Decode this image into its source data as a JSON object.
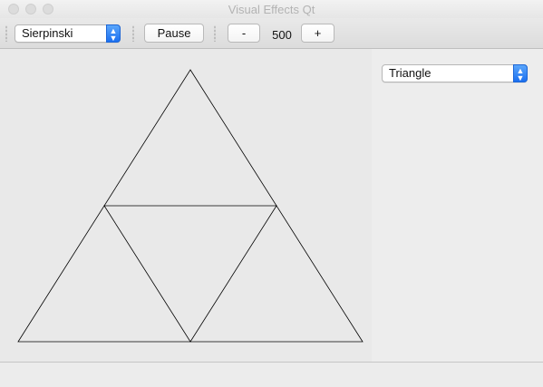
{
  "window": {
    "title": "Visual Effects Qt"
  },
  "toolbar": {
    "effect_select": {
      "value": "Sierpinski"
    },
    "pause_label": "Pause",
    "decrement_label": "-",
    "count_value": "500",
    "increment_label": "+"
  },
  "side_panel": {
    "shape_select": {
      "value": "Triangle"
    }
  },
  "colors": {
    "accent": "#1b6ff0",
    "line": "#000000"
  },
  "icons": {
    "select_arrows": "chevron-up-down-icon"
  }
}
